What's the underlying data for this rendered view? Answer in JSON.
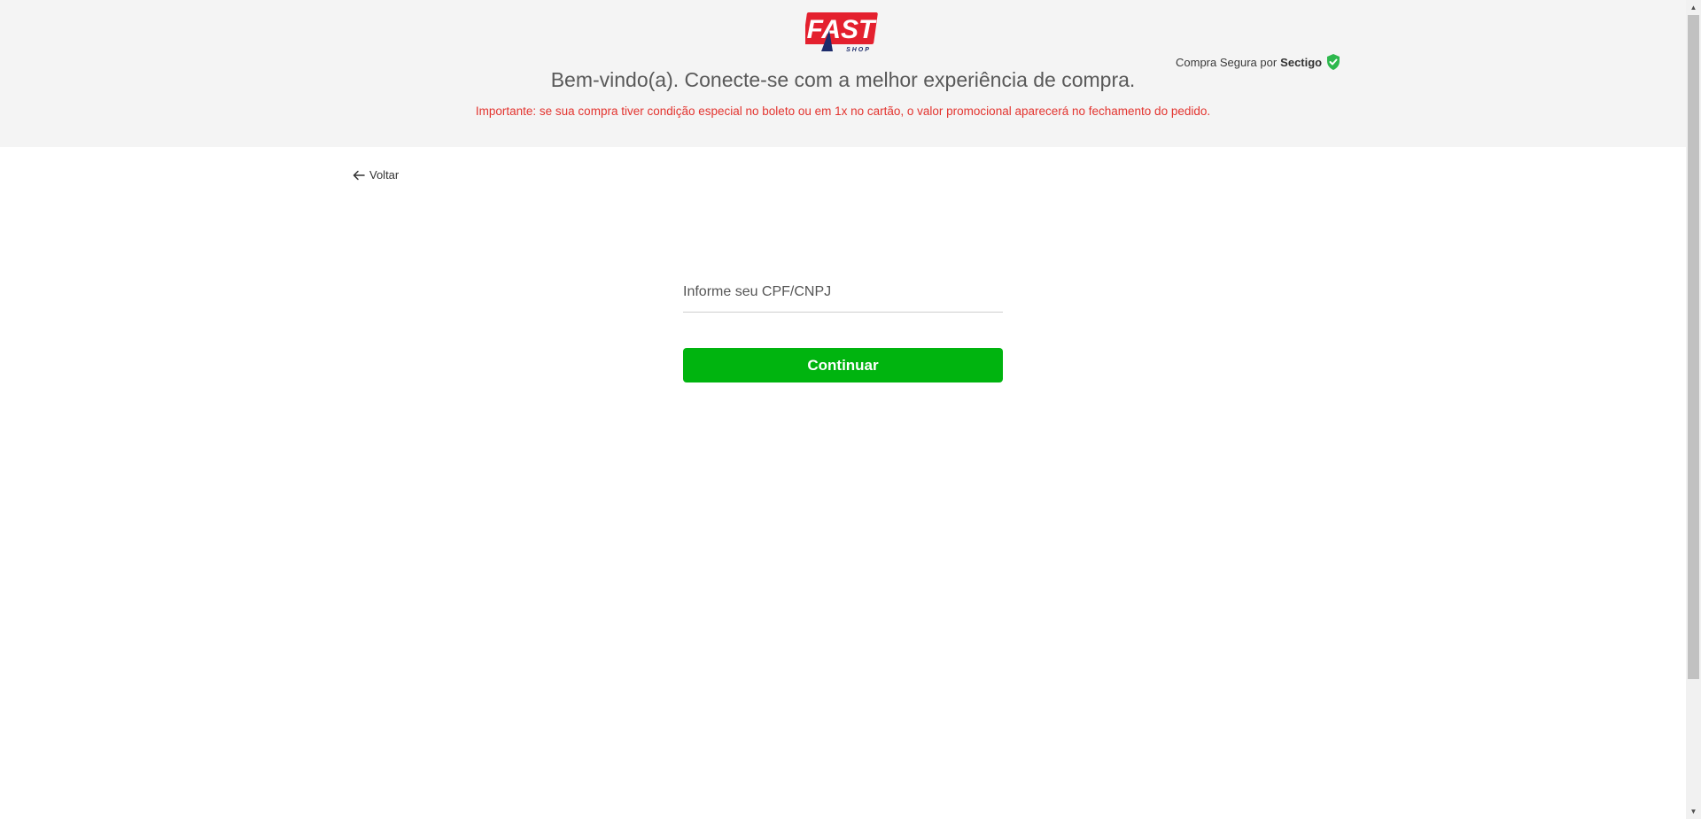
{
  "header": {
    "logo_text": "FAST SHOP",
    "secure_prefix": "Compra Segura por",
    "secure_brand": "Sectigo",
    "welcome": "Bem-vindo(a). Conecte-se com a melhor experiência de compra.",
    "notice": "Importante: se sua compra tiver condição especial no boleto ou em 1x no cartão, o valor promocional aparecerá no fechamento do pedido."
  },
  "nav": {
    "back_label": "Voltar"
  },
  "form": {
    "cpf_placeholder": "Informe seu CPF/CNPJ",
    "cpf_value": "",
    "continue_label": "Continuar"
  },
  "colors": {
    "brand_red": "#e4202e",
    "brand_navy": "#1c2b6b",
    "button_green": "#00b40f",
    "notice_red": "#e3342f",
    "shield_green": "#2db84d"
  }
}
